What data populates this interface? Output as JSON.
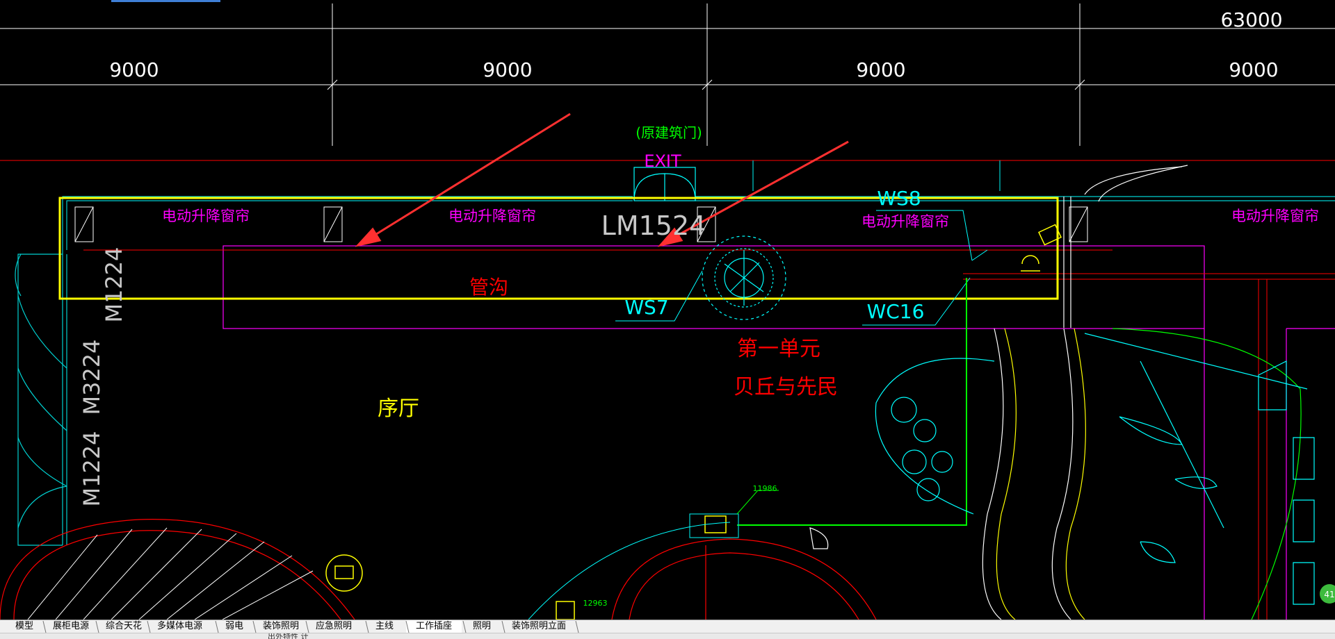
{
  "dimensions": {
    "total": "63000",
    "spans": [
      "9000",
      "9000",
      "9000",
      "9000"
    ]
  },
  "labels": {
    "original_door": "(原建筑门)",
    "exit": "EXIT",
    "lm1524": "LM1524",
    "ws8": "WS8",
    "ws7": "WS7",
    "wc16": "WC16",
    "curtain_1": "电动升降窗帘",
    "curtain_2": "电动升降窗帘",
    "curtain_3": "电动升降窗帘",
    "curtain_4": "电动升降窗帘",
    "trench": "管沟",
    "unit_1": "第一单元",
    "unit_1_sub": "贝丘与先民",
    "prelude_hall": "序厅",
    "m1224_top": "M1224",
    "m3224": "M3224",
    "m1224_bottom": "M1224",
    "tag_11986": "11986",
    "tag_12963": "12963",
    "corner_badge": "41"
  },
  "colors": {
    "highlight_box": "#ffff00",
    "arrow": "#ff3030",
    "magenta": "#ff00ff",
    "cyan": "#00ffff",
    "red": "#ff0000",
    "green": "#00ff00"
  },
  "tabs": [
    {
      "label": "模型",
      "active": false
    },
    {
      "label": "展柜电源",
      "active": false
    },
    {
      "label": "综合天花",
      "active": false
    },
    {
      "label": "多媒体电源",
      "active": false
    },
    {
      "label": "弱电",
      "active": false
    },
    {
      "label": "装饰照明",
      "active": false
    },
    {
      "label": "应急照明",
      "active": false
    },
    {
      "label": "主线",
      "active": false
    },
    {
      "label": "工作插座",
      "active": true
    },
    {
      "label": "照明",
      "active": false
    },
    {
      "label": "装饰照明立面",
      "active": false
    }
  ],
  "status_text": "出外特性 计"
}
